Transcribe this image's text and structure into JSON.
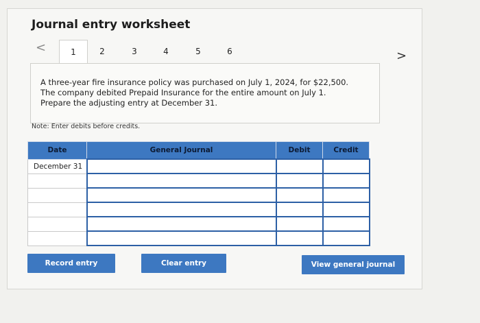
{
  "page": {
    "title": "Journal entry worksheet"
  },
  "nav": {
    "prev_glyph": "<",
    "next_glyph": ">",
    "tabs": [
      "1",
      "2",
      "3",
      "4",
      "5",
      "6"
    ],
    "active_tab": "1"
  },
  "question": {
    "text_lines": [
      "A three-year fire insurance policy was purchased on July 1, 2024, for $22,500.",
      "The company debited Prepaid Insurance for the entire amount on July 1.",
      "Prepare the adjusting entry at December 31."
    ]
  },
  "note": "Note: Enter debits before credits.",
  "table": {
    "headers": {
      "date": "Date",
      "journal": "General Journal",
      "debit": "Debit",
      "credit": "Credit"
    },
    "rows": [
      {
        "date": "December 31",
        "journal": "",
        "debit": "",
        "credit": ""
      },
      {
        "date": "",
        "journal": "",
        "debit": "",
        "credit": ""
      },
      {
        "date": "",
        "journal": "",
        "debit": "",
        "credit": ""
      },
      {
        "date": "",
        "journal": "",
        "debit": "",
        "credit": ""
      },
      {
        "date": "",
        "journal": "",
        "debit": "",
        "credit": ""
      },
      {
        "date": "",
        "journal": "",
        "debit": "",
        "credit": ""
      }
    ]
  },
  "buttons": {
    "record": "Record entry",
    "clear": "Clear entry",
    "view": "View general journal"
  },
  "colors": {
    "accent": "#3d78c1",
    "entry_border": "#2c5fa5"
  }
}
